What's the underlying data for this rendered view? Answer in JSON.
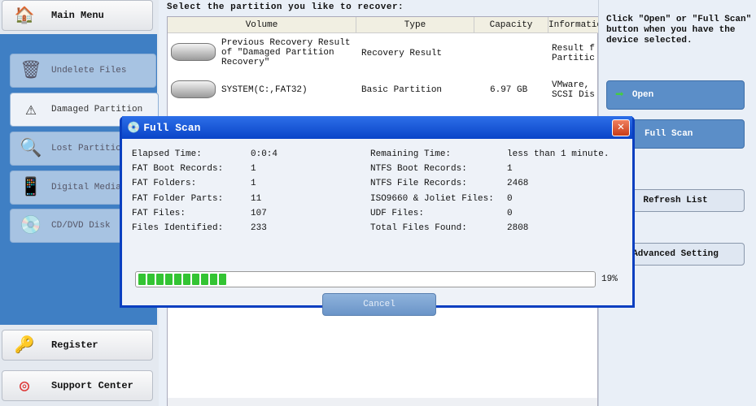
{
  "sidebar": {
    "main_menu": "Main Menu",
    "items": [
      {
        "label": "Undelete Files",
        "icon": "recycle-bin-icon"
      },
      {
        "label": "Damaged Partition",
        "icon": "damaged-disk-icon"
      },
      {
        "label": "Lost Partition",
        "icon": "lost-partition-icon"
      },
      {
        "label": "Digital Media",
        "icon": "digital-media-icon"
      },
      {
        "label": "CD/DVD Disk",
        "icon": "cd-dvd-icon"
      }
    ],
    "register": "Register",
    "support": "Support Center"
  },
  "main": {
    "prompt": "Select the partition you like to recover:",
    "columns": [
      "Volume",
      "Type",
      "Capacity",
      "Information"
    ],
    "rows": [
      {
        "volume": "Previous Recovery Result of \"Damaged Partition Recovery\"",
        "type": "Recovery Result",
        "capacity": "",
        "info": "Result f Partitic"
      },
      {
        "volume": "SYSTEM(C:,FAT32)",
        "type": "Basic Partition",
        "capacity": "6.97 GB",
        "info": "VMware, SCSI Dis"
      }
    ]
  },
  "right": {
    "hint": "Click \"Open\" or \"Full Scan\" button when you have the device selected.",
    "open": "Open",
    "full_scan": "Full Scan",
    "refresh": "Refresh List",
    "advanced": "Advanced Setting"
  },
  "dialog": {
    "title": "Full Scan",
    "left": [
      {
        "label": "Elapsed Time:",
        "value": "0:0:4"
      },
      {
        "label": "FAT Boot Records:",
        "value": "1"
      },
      {
        "label": "FAT Folders:",
        "value": "1"
      },
      {
        "label": "FAT Folder Parts:",
        "value": "11"
      },
      {
        "label": "FAT Files:",
        "value": "107"
      },
      {
        "label": "Files Identified:",
        "value": "233"
      }
    ],
    "right": [
      {
        "label": "Remaining Time:",
        "value": "less than 1 minute."
      },
      {
        "label": "NTFS Boot Records:",
        "value": "1"
      },
      {
        "label": "NTFS File Records:",
        "value": "2468"
      },
      {
        "label": "ISO9660 & Joliet Files:",
        "value": "0"
      },
      {
        "label": "UDF Files:",
        "value": "0"
      },
      {
        "label": "Total Files Found:",
        "value": "2808"
      }
    ],
    "progress": 19,
    "progress_text": "19%",
    "cancel": "Cancel"
  },
  "colors": {
    "sidebar_blue": "#3f7fc4",
    "progress_green": "#33c433",
    "title_blue": "#0a44c8"
  }
}
